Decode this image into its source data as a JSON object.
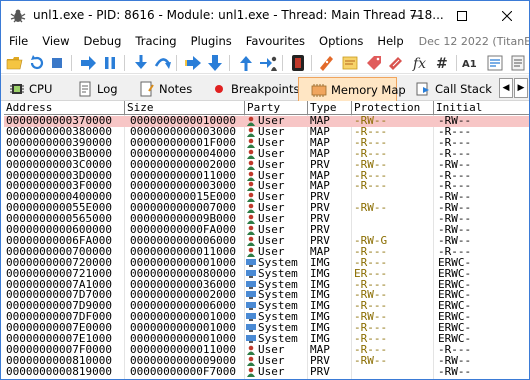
{
  "window": {
    "title": "unl1.exe - PID: 8616 - Module: unl1.exe - Thread: Main Thread 718..."
  },
  "menu": {
    "items": [
      "File",
      "View",
      "Debug",
      "Tracing",
      "Plugins",
      "Favourites",
      "Options",
      "Help"
    ],
    "date": "Dec 12 2022 (TitanEngine)"
  },
  "tabs": [
    {
      "label": "CPU",
      "icon": "cpu-icon"
    },
    {
      "label": "Log",
      "icon": "log-icon"
    },
    {
      "label": "Notes",
      "icon": "notes-icon"
    },
    {
      "label": "Breakpoints",
      "icon": "breakpoint-dot-icon"
    },
    {
      "label": "Memory Map",
      "icon": "memory-map-icon",
      "active": true
    },
    {
      "label": "Call Stack",
      "icon": "call-stack-icon"
    }
  ],
  "colors": {
    "selected_row": "#f7c6c6",
    "active_tab": "#ffe6c4",
    "window_border": "#3b7bd6"
  },
  "table": {
    "columns": [
      "Address",
      "Size",
      "Party",
      "Type",
      "Protection",
      "Initial"
    ],
    "rows": [
      {
        "address": "0000000000370000",
        "size": "0000000000010000",
        "party": "User",
        "type": "MAP",
        "protection": "-RW--",
        "initial": "-RW--",
        "selected": true
      },
      {
        "address": "0000000000380000",
        "size": "0000000000003000",
        "party": "User",
        "type": "MAP",
        "protection": "-R---",
        "initial": "-R---"
      },
      {
        "address": "0000000000390000",
        "size": "000000000001F000",
        "party": "User",
        "type": "MAP",
        "protection": "-R---",
        "initial": "-R---"
      },
      {
        "address": "00000000003B0000",
        "size": "0000000000004000",
        "party": "User",
        "type": "MAP",
        "protection": "-R---",
        "initial": "-R---"
      },
      {
        "address": "00000000003C0000",
        "size": "0000000000002000",
        "party": "User",
        "type": "PRV",
        "protection": "-RW--",
        "initial": "-RW--"
      },
      {
        "address": "00000000003D0000",
        "size": "0000000000011000",
        "party": "User",
        "type": "MAP",
        "protection": "-R---",
        "initial": "-R---"
      },
      {
        "address": "00000000003F0000",
        "size": "0000000000003000",
        "party": "User",
        "type": "MAP",
        "protection": "-R---",
        "initial": "-R---"
      },
      {
        "address": "0000000000400000",
        "size": "000000000015E000",
        "party": "User",
        "type": "PRV",
        "protection": "",
        "initial": "-RW--"
      },
      {
        "address": "000000000055E000",
        "size": "0000000000007000",
        "party": "User",
        "type": "PRV",
        "protection": "-RW--",
        "initial": "-RW--"
      },
      {
        "address": "0000000000565000",
        "size": "000000000009B000",
        "party": "User",
        "type": "PRV",
        "protection": "",
        "initial": "-RW--"
      },
      {
        "address": "0000000000600000",
        "size": "00000000000FA000",
        "party": "User",
        "type": "PRV",
        "protection": "",
        "initial": "-RW--"
      },
      {
        "address": "00000000006FA000",
        "size": "0000000000006000",
        "party": "User",
        "type": "PRV",
        "protection": "-RW-G",
        "initial": "-RW--"
      },
      {
        "address": "0000000000700000",
        "size": "0000000000011000",
        "party": "User",
        "type": "MAP",
        "protection": "-R---",
        "initial": "-R---"
      },
      {
        "address": "0000000000720000",
        "size": "0000000000001000",
        "party": "System",
        "type": "IMG",
        "protection": "-R---",
        "initial": "ERWC-"
      },
      {
        "address": "0000000000721000",
        "size": "0000000000080000",
        "party": "System",
        "type": "IMG",
        "protection": "ER---",
        "initial": "ERWC-"
      },
      {
        "address": "00000000007A1000",
        "size": "0000000000036000",
        "party": "System",
        "type": "IMG",
        "protection": "-R---",
        "initial": "ERWC-"
      },
      {
        "address": "00000000007D7000",
        "size": "0000000000002000",
        "party": "System",
        "type": "IMG",
        "protection": "-RW--",
        "initial": "ERWC-"
      },
      {
        "address": "00000000007D9000",
        "size": "0000000000006000",
        "party": "System",
        "type": "IMG",
        "protection": "-R---",
        "initial": "ERWC-"
      },
      {
        "address": "00000000007DF000",
        "size": "0000000000001000",
        "party": "System",
        "type": "IMG",
        "protection": "-RW--",
        "initial": "ERWC-"
      },
      {
        "address": "00000000007E0000",
        "size": "0000000000001000",
        "party": "System",
        "type": "IMG",
        "protection": "-R---",
        "initial": "ERWC-"
      },
      {
        "address": "00000000007E1000",
        "size": "0000000000001000",
        "party": "System",
        "type": "IMG",
        "protection": "-R---",
        "initial": "ERWC-"
      },
      {
        "address": "00000000007F0000",
        "size": "0000000000011000",
        "party": "User",
        "type": "MAP",
        "protection": "-R---",
        "initial": "-R---"
      },
      {
        "address": "0000000000810000",
        "size": "0000000000009000",
        "party": "User",
        "type": "PRV",
        "protection": "-RW--",
        "initial": "-RW--"
      },
      {
        "address": "0000000000819000",
        "size": "00000000000F7000",
        "party": "User",
        "type": "PRV",
        "protection": "",
        "initial": "-RW--"
      }
    ]
  }
}
